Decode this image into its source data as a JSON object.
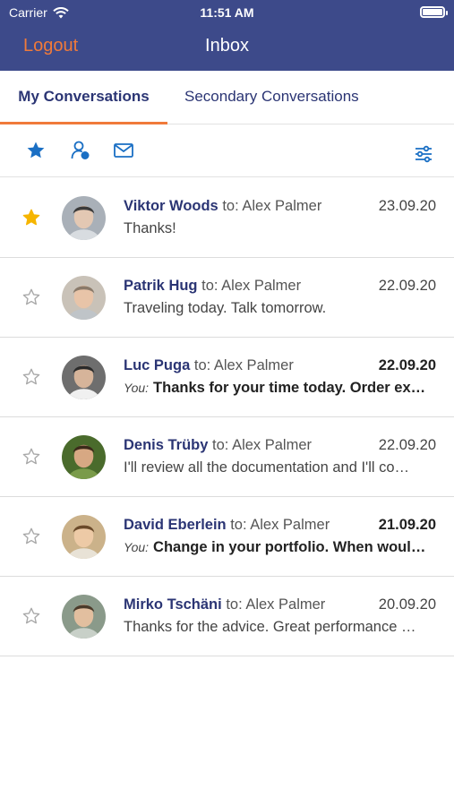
{
  "status_bar": {
    "carrier": "Carrier",
    "time": "11:51 AM",
    "battery_level": 0.9
  },
  "nav": {
    "logout_label": "Logout",
    "title": "Inbox"
  },
  "tabs": [
    {
      "label": "My Conversations",
      "active": true
    },
    {
      "label": "Secondary Conversations",
      "active": false
    }
  ],
  "toolbar": {
    "icons": [
      "star-icon",
      "person-online-icon",
      "envelope-icon",
      "filter-sliders-icon"
    ]
  },
  "colors": {
    "header": "#3d4a8a",
    "accent": "#f07a3a",
    "link": "#2b3574",
    "star_active": "#f6b500",
    "icon_blue": "#1a6fc4"
  },
  "conversations": [
    {
      "sender": "Viktor Woods",
      "to": "to: Alex Palmer",
      "date": "23.09.20",
      "you_prefix": "",
      "preview": "Thanks!",
      "starred": true,
      "unread": false
    },
    {
      "sender": "Patrik Hug",
      "to": "to: Alex Palmer",
      "date": "22.09.20",
      "you_prefix": "",
      "preview": "Traveling today. Talk tomorrow.",
      "starred": false,
      "unread": false
    },
    {
      "sender": "Luc Puga",
      "to": "to: Alex Palmer",
      "date": "22.09.20",
      "you_prefix": "You:",
      "preview": "Thanks for your time today. Order ex…",
      "starred": false,
      "unread": true
    },
    {
      "sender": "Denis Trüby",
      "to": "to: Alex Palmer",
      "date": "22.09.20",
      "you_prefix": "",
      "preview": "I'll review all the documentation and I'll co…",
      "starred": false,
      "unread": false
    },
    {
      "sender": "David Eberlein",
      "to": "to: Alex Palmer",
      "date": "21.09.20",
      "you_prefix": "You:",
      "preview": "Change in your portfolio. When woul…",
      "starred": false,
      "unread": true
    },
    {
      "sender": "Mirko Tschäni",
      "to": "to: Alex Palmer",
      "date": "20.09.20",
      "you_prefix": "",
      "preview": "Thanks for the advice. Great performance …",
      "starred": false,
      "unread": false
    }
  ]
}
